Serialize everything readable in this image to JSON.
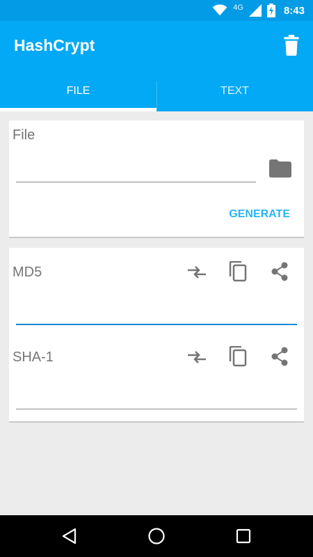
{
  "status_bar": {
    "network": "4G",
    "time": "8:43"
  },
  "app": {
    "title": "HashCrypt",
    "delete_icon": "trash-icon"
  },
  "tabs": [
    {
      "label": "FILE",
      "active": true
    },
    {
      "label": "TEXT",
      "active": false
    }
  ],
  "file_card": {
    "label": "File",
    "value": "",
    "browse_icon": "folder-icon",
    "generate_label": "GENERATE"
  },
  "hashes": [
    {
      "label": "MD5",
      "value": "",
      "focused": true
    },
    {
      "label": "SHA-1",
      "value": "",
      "focused": false
    }
  ],
  "hash_actions": [
    "compare-icon",
    "copy-icon",
    "share-icon"
  ],
  "colors": {
    "primary": "#03a9f4",
    "primary_dark": "#039be5",
    "accent": "#29b6f6",
    "focus_line": "#0288d1"
  },
  "nav": [
    "back-icon",
    "home-icon",
    "recents-icon"
  ]
}
